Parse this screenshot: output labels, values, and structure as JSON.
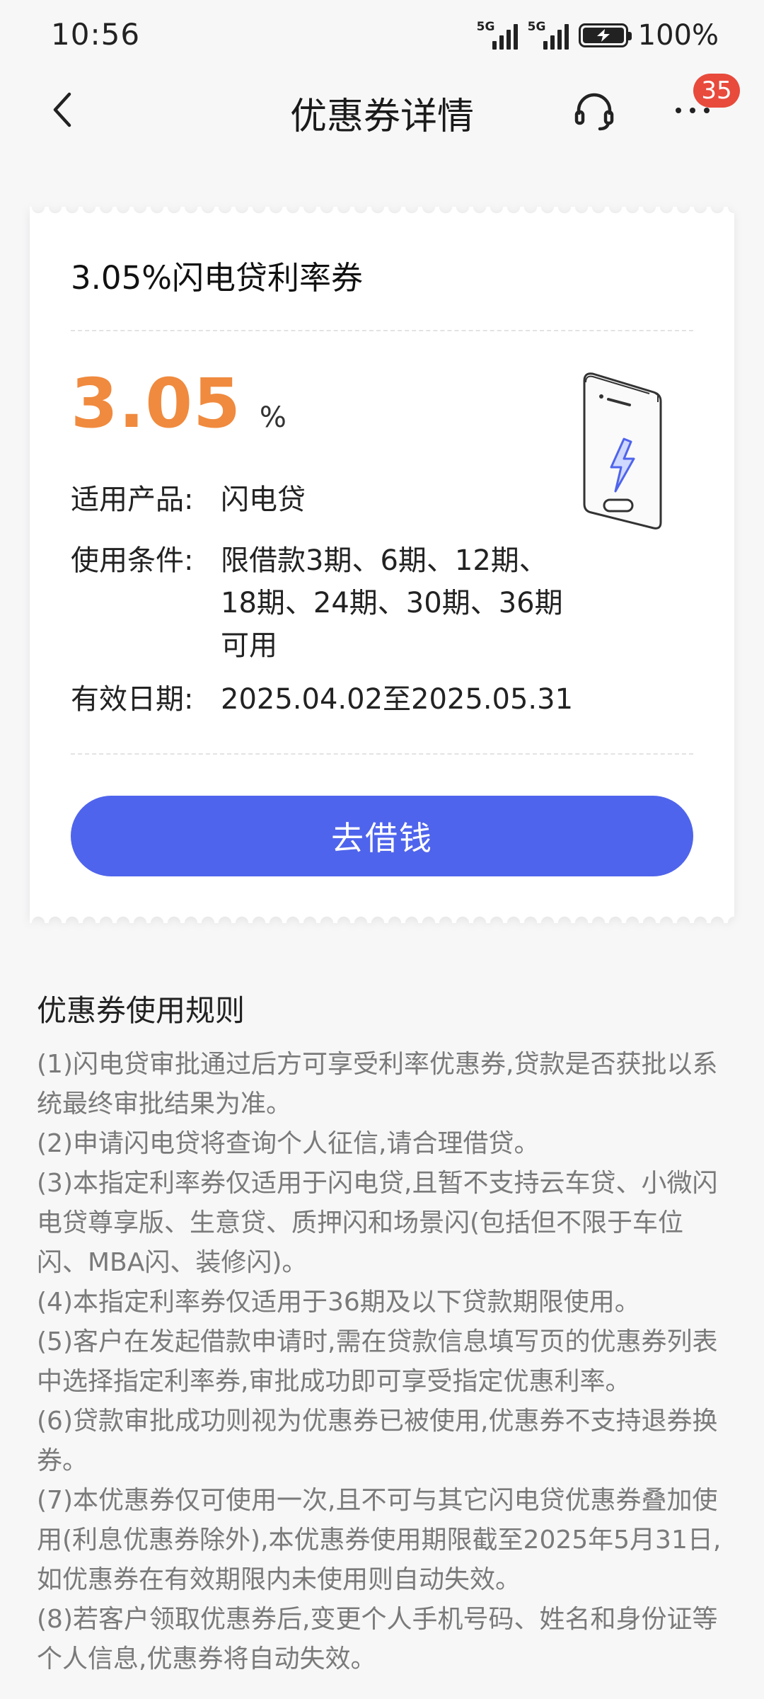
{
  "status_bar": {
    "time": "10:56",
    "network_1": "5G",
    "network_2": "5G",
    "battery": "100%"
  },
  "nav": {
    "title": "优惠券详情",
    "badge_count": "35",
    "icons": [
      "chevron-left-icon",
      "headset-icon",
      "more-icon"
    ]
  },
  "coupon": {
    "title": "3.05%闪电贷利率券",
    "rate_value": "3.05",
    "rate_unit": "%",
    "product_label": "适用产品:",
    "product_value": "闪电贷",
    "condition_label": "使用条件:",
    "condition_value": "限借款3期、6期、12期、18期、24期、30期、36期可用",
    "validity_label": "有效日期:",
    "validity_value": "2025.04.02至2025.05.31",
    "button_label": "去借钱",
    "accent_color": "#f08a3e",
    "button_color": "#4f64ec"
  },
  "rules": {
    "title": "优惠券使用规则",
    "items": [
      "(1)闪电贷审批通过后方可享受利率优惠券,贷款是否获批以系统最终审批结果为准。",
      "(2)申请闪电贷将查询个人征信,请合理借贷。",
      "(3)本指定利率券仅适用于闪电贷,且暂不支持云车贷、小微闪电贷尊享版、生意贷、质押闪和场景闪(包括但不限于车位闪、MBA闪、装修闪)。",
      "(4)本指定利率券仅适用于36期及以下贷款期限使用。",
      "(5)客户在发起借款申请时,需在贷款信息填写页的优惠券列表中选择指定利率券,审批成功即可享受指定优惠利率。",
      "(6)贷款审批成功则视为优惠券已被使用,优惠券不支持退券换券。",
      "(7)本优惠券仅可使用一次,且不可与其它闪电贷优惠券叠加使用(利息优惠券除外),本优惠券使用期限截至2025年5月31日,如优惠券在有效期限内未使用则自动失效。",
      "(8)若客户领取优惠券后,变更个人手机号码、姓名和身份证等个人信息,优惠券将自动失效。"
    ]
  }
}
